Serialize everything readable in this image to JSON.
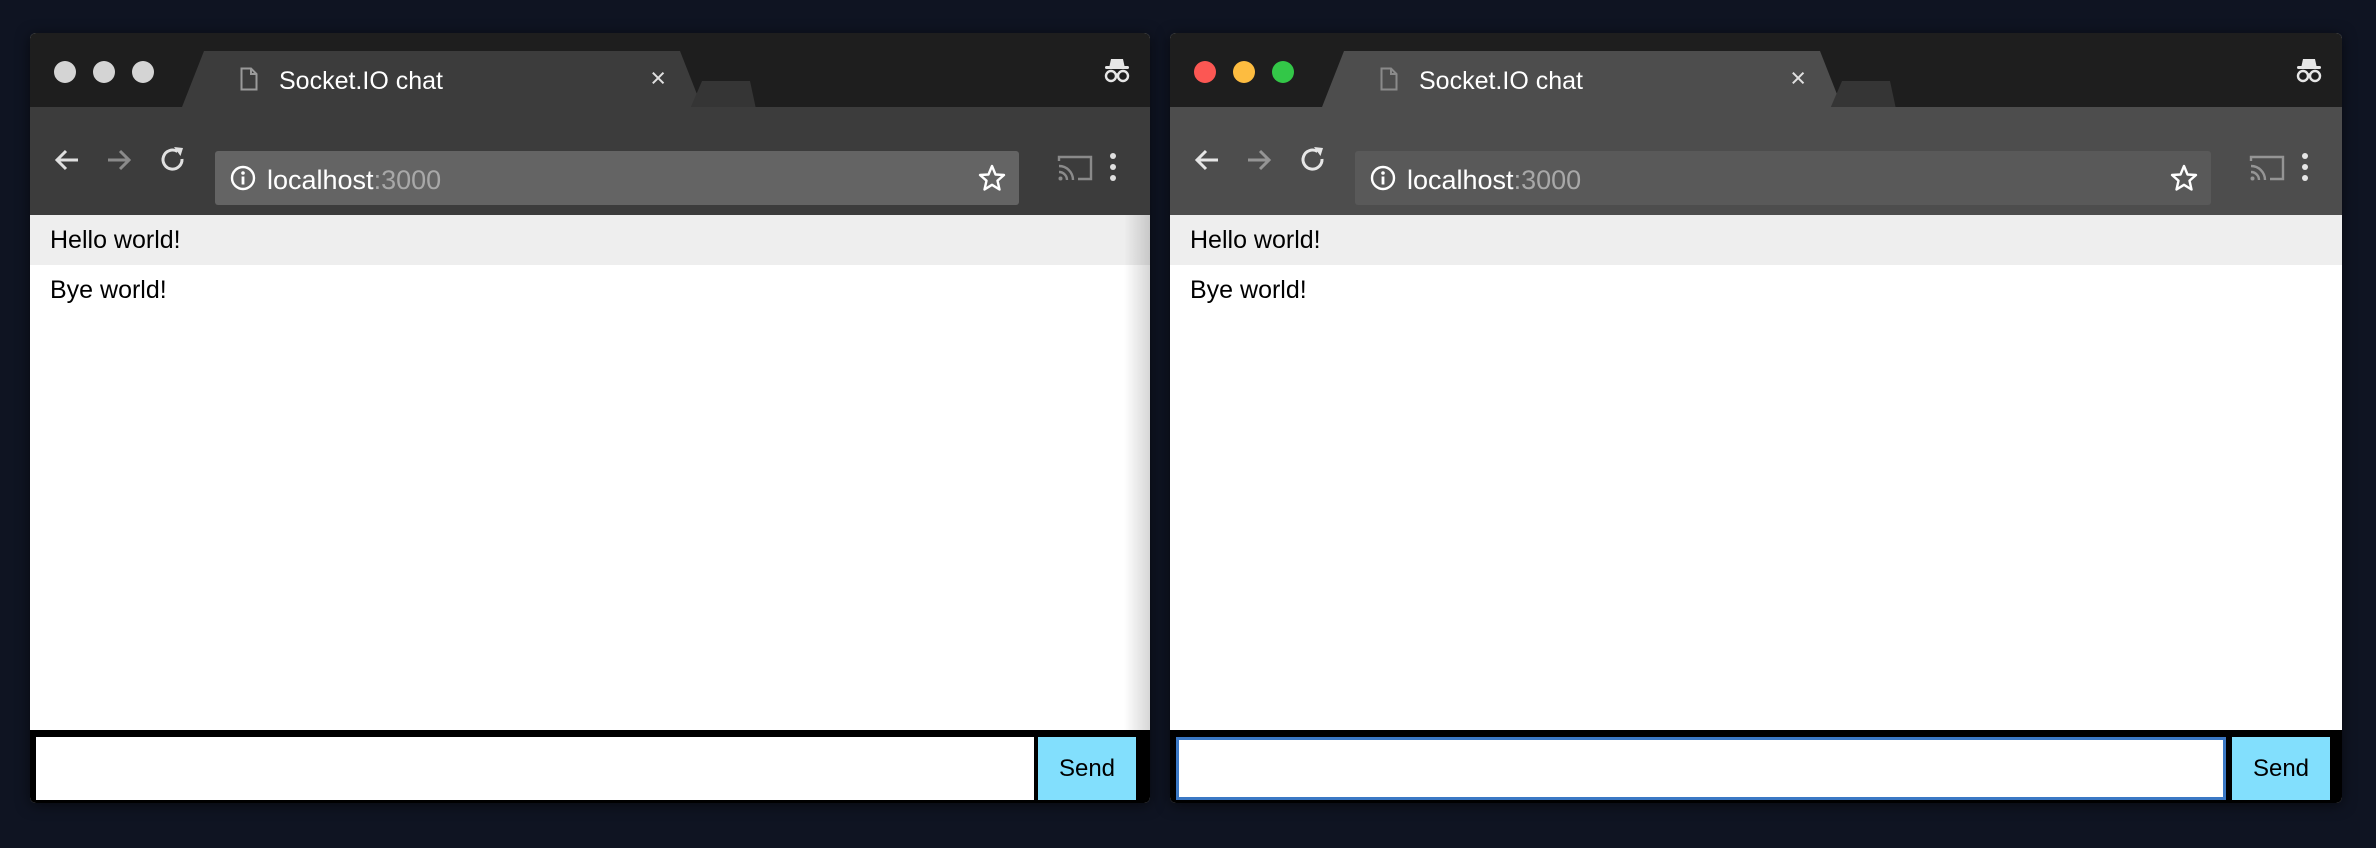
{
  "windows": [
    {
      "id": "left",
      "incognito": true,
      "focused": false,
      "tab": {
        "title": "Socket.IO chat",
        "close_glyph": "×",
        "icon": "page-icon"
      },
      "address": {
        "host": "localhost",
        "port": ":3000"
      },
      "messages": [
        "Hello world!",
        "Bye world!"
      ],
      "form": {
        "input_value": "",
        "send_label": "Send"
      }
    },
    {
      "id": "right",
      "incognito": true,
      "focused": true,
      "tab": {
        "title": "Socket.IO chat",
        "close_glyph": "×",
        "icon": "page-icon"
      },
      "address": {
        "host": "localhost",
        "port": ":3000"
      },
      "messages": [
        "Hello world!",
        "Bye world!"
      ],
      "form": {
        "input_value": "",
        "send_label": "Send"
      }
    }
  ],
  "colors": {
    "desktop": "#0f1422",
    "send_button": "#82dffd",
    "message_stripe": "#eeeeee",
    "focus_ring": "#3b78c4",
    "traffic_red": "#fc5753",
    "traffic_yellow": "#fdbc40",
    "traffic_green": "#33c748"
  }
}
